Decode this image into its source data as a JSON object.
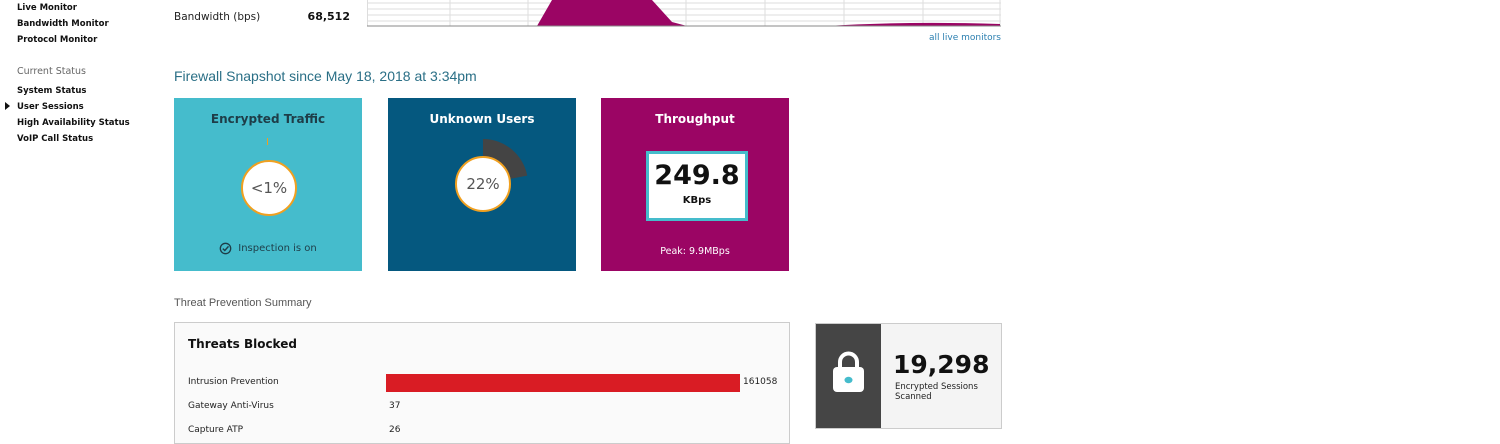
{
  "sidebar": {
    "links_top": [
      "Live Monitor",
      "Bandwidth Monitor",
      "Protocol Monitor"
    ],
    "section_header": "Current Status",
    "links_status": [
      "System Status",
      "User Sessions",
      "High Availability Status",
      "VoIP Call Status"
    ],
    "active_item": "User Sessions"
  },
  "bandwidth": {
    "label": "Bandwidth (bps)",
    "value": "68,512",
    "chart_color": "#9b0564",
    "all_monitors_link": "all live monitors"
  },
  "snapshot": {
    "title": "Firewall Snapshot since May 18, 2018 at 3:34pm"
  },
  "tiles": {
    "encrypted": {
      "title": "Encrypted Traffic",
      "value": "<1%",
      "status": "Inspection is on",
      "color": "#45bccc"
    },
    "unknown": {
      "title": "Unknown Users",
      "value": "22%",
      "percent": 22,
      "color": "#05587f"
    },
    "throughput": {
      "title": "Throughput",
      "value": "249.8",
      "unit": "KBps",
      "peak": "Peak: 9.9MBps",
      "color": "#9b0564"
    }
  },
  "threat_prevention": {
    "title": "Threat Prevention Summary",
    "box_title": "Threats Blocked",
    "bar_color": "#d91c24",
    "rows": [
      {
        "name": "Intrusion Prevention",
        "count": "161058",
        "value": 161058
      },
      {
        "name": "Gateway Anti-Virus",
        "count": "37",
        "value": 37
      },
      {
        "name": "Capture ATP",
        "count": "26",
        "value": 26
      }
    ]
  },
  "encrypted_sessions": {
    "value": "19,298",
    "label": "Encrypted Sessions Scanned"
  }
}
